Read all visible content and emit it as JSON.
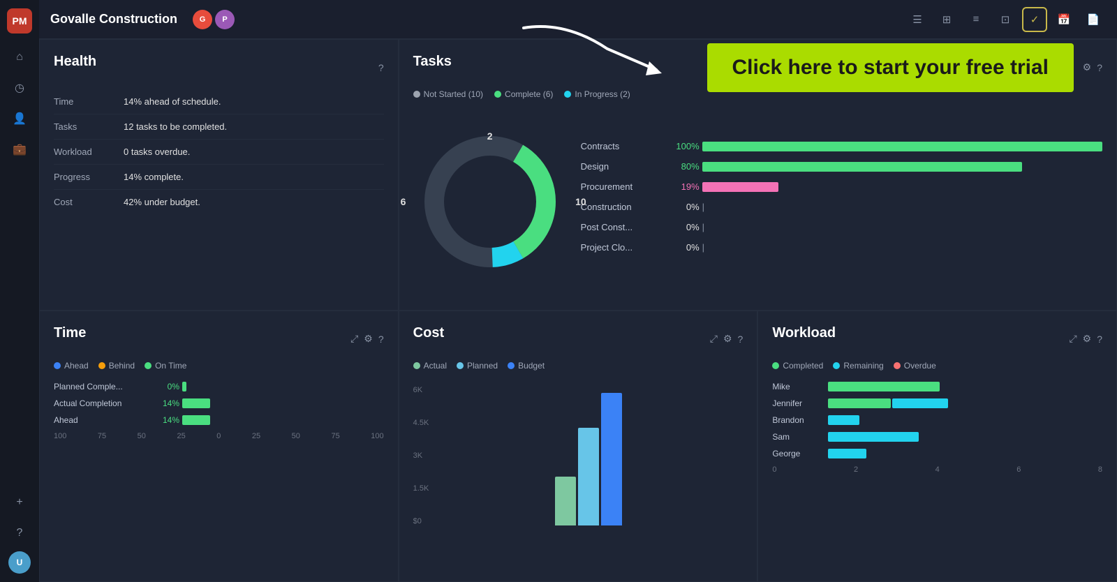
{
  "app": {
    "name": "PM",
    "title": "Govalle Construction"
  },
  "sidebar": {
    "icons": [
      "⌂",
      "◷",
      "👤",
      "💼"
    ],
    "bottom_icons": [
      "+",
      "?"
    ],
    "avatar_initials": "U"
  },
  "header": {
    "title": "Govalle Construction",
    "avatars": [
      {
        "initials": "G",
        "color": "#e74c3c"
      },
      {
        "initials": "P",
        "color": "#9b59b6"
      }
    ],
    "toolbar_buttons": [
      "≡",
      "⊞",
      "≡",
      "⊡",
      "✓",
      "📅",
      "📄"
    ]
  },
  "cta": {
    "text": "Click here to start your free trial"
  },
  "health": {
    "title": "Health",
    "rows": [
      {
        "label": "Time",
        "value": "14% ahead of schedule."
      },
      {
        "label": "Tasks",
        "value": "12 tasks to be completed."
      },
      {
        "label": "Workload",
        "value": "0 tasks overdue."
      },
      {
        "label": "Progress",
        "value": "14% complete."
      },
      {
        "label": "Cost",
        "value": "42% under budget."
      }
    ]
  },
  "tasks": {
    "title": "Tasks",
    "legend": [
      {
        "label": "Not Started (10)",
        "color": "#9ca3af"
      },
      {
        "label": "Complete (6)",
        "color": "#4ade80"
      },
      {
        "label": "In Progress (2)",
        "color": "#22d3ee"
      }
    ],
    "donut": {
      "not_started": 10,
      "complete": 6,
      "in_progress": 2,
      "labels": {
        "left": "6",
        "right": "10",
        "top": "2"
      }
    },
    "progress_bars": [
      {
        "label": "Contracts",
        "pct": "100%",
        "pct_color": "green",
        "fill": "#4ade80",
        "width": 100
      },
      {
        "label": "Design",
        "pct": "80%",
        "pct_color": "green",
        "fill": "#4ade80",
        "width": 80
      },
      {
        "label": "Procurement",
        "pct": "19%",
        "pct_color": "pink",
        "fill": "#f472b6",
        "width": 19
      },
      {
        "label": "Construction",
        "pct": "0%",
        "pct_color": "",
        "fill": "transparent",
        "width": 0
      },
      {
        "label": "Post Const...",
        "pct": "0%",
        "pct_color": "",
        "fill": "transparent",
        "width": 0
      },
      {
        "label": "Project Clo...",
        "pct": "0%",
        "pct_color": "",
        "fill": "transparent",
        "width": 0
      }
    ]
  },
  "time": {
    "title": "Time",
    "legend": [
      {
        "label": "Ahead",
        "color": "#3b82f6"
      },
      {
        "label": "Behind",
        "color": "#f59e0b"
      },
      {
        "label": "On Time",
        "color": "#4ade80"
      }
    ],
    "rows": [
      {
        "label": "Planned Comple...",
        "pct": "0%",
        "width": 0
      },
      {
        "label": "Actual Completion",
        "pct": "14%",
        "width": 14
      },
      {
        "label": "Ahead",
        "pct": "14%",
        "width": 14
      }
    ],
    "axis": [
      "100",
      "75",
      "50",
      "25",
      "0",
      "25",
      "50",
      "75",
      "100"
    ]
  },
  "cost": {
    "title": "Cost",
    "legend": [
      {
        "label": "Actual",
        "color": "#7ec8a0"
      },
      {
        "label": "Planned",
        "color": "#67c5e8"
      },
      {
        "label": "Budget",
        "color": "#3b82f6"
      }
    ],
    "y_labels": [
      "6K",
      "4.5K",
      "3K",
      "1.5K",
      "$0"
    ],
    "bars": [
      {
        "actual": 60,
        "planned": 130,
        "budget": 190
      }
    ]
  },
  "workload": {
    "title": "Workload",
    "legend": [
      {
        "label": "Completed",
        "color": "#4ade80"
      },
      {
        "label": "Remaining",
        "color": "#22d3ee"
      },
      {
        "label": "Overdue",
        "color": "#f87171"
      }
    ],
    "rows": [
      {
        "name": "Mike",
        "completed": 180,
        "remaining": 0,
        "overdue": 0
      },
      {
        "name": "Jennifer",
        "completed": 100,
        "remaining": 80,
        "overdue": 0
      },
      {
        "name": "Brandon",
        "completed": 0,
        "remaining": 50,
        "overdue": 0
      },
      {
        "name": "Sam",
        "completed": 0,
        "remaining": 140,
        "overdue": 0
      },
      {
        "name": "George",
        "completed": 0,
        "remaining": 60,
        "overdue": 0
      }
    ],
    "axis": [
      "0",
      "2",
      "4",
      "6",
      "8"
    ]
  }
}
